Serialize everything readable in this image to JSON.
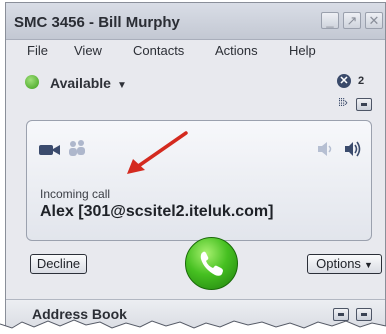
{
  "window": {
    "title": "SMC 3456 - Bill Murphy"
  },
  "menu": [
    "File",
    "View",
    "Contacts",
    "Actions",
    "Help"
  ],
  "status": {
    "label": "Available",
    "missed_count": "2"
  },
  "call": {
    "incoming_label": "Incoming call",
    "caller": "Alex [301@scsitel2.iteluk.com]",
    "decline_label": "Decline",
    "options_label": "Options"
  },
  "address_book": {
    "label": "Address Book"
  },
  "colors": {
    "accent_red": "#d42a1f",
    "answer_green": "#46c021"
  }
}
